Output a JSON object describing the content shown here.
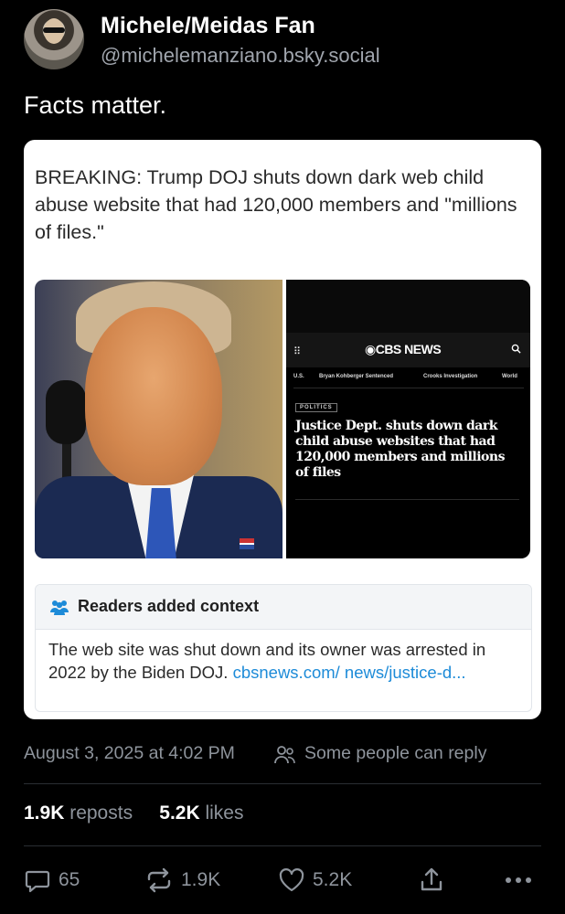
{
  "author": {
    "display_name": "Michele/Meidas Fan",
    "handle": "@michelemanziano.bsky.social"
  },
  "post": {
    "text": "Facts matter."
  },
  "embedded_card": {
    "headline": "BREAKING: Trump DOJ shuts down dark web child abuse website that had 120,000 members and \"millions of files.\"",
    "cbs": {
      "logo": "◉CBS NEWS",
      "nav_items": [
        "U.S.",
        "Bryan Kohberger Sentenced",
        "Crooks Investigation",
        "World"
      ],
      "tag": "POLITICS",
      "headline": "Justice Dept. shuts down dark child abuse websites that had 120,000 members and millions of files"
    },
    "context": {
      "title": "Readers added context",
      "body": "The web site was shut down and its owner was arrested in 2022 by the Biden DOJ. ",
      "link": "cbsnews.com/ news/justice-d..."
    }
  },
  "meta": {
    "timestamp": "August 3, 2025 at 4:02 PM",
    "reply_setting": "Some people can reply"
  },
  "stats": {
    "reposts_num": "1.9K",
    "reposts_label": "reposts",
    "likes_num": "5.2K",
    "likes_label": "likes"
  },
  "actions": {
    "replies": "65",
    "reposts": "1.9K",
    "likes": "5.2K"
  },
  "colors": {
    "background": "#000000",
    "muted_text": "#8e949c",
    "link": "#1d8bd8"
  }
}
